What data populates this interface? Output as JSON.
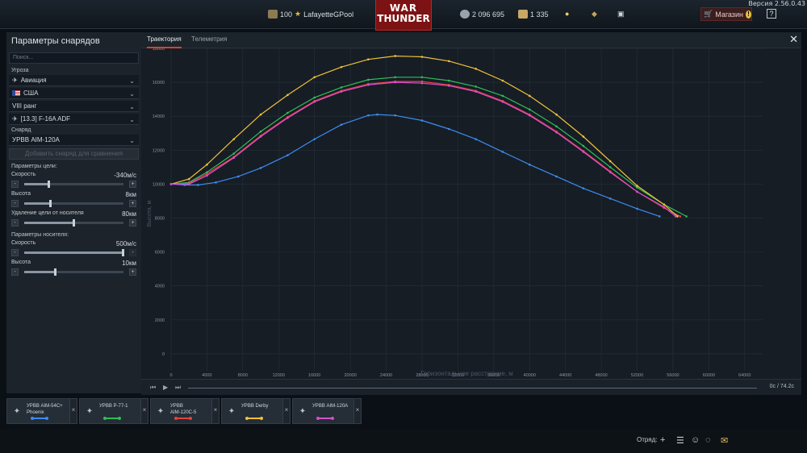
{
  "version": "Версия 2.56.0.43",
  "topbar": {
    "level": "100",
    "username": "LafayetteGPool",
    "logo_line1": "WAR",
    "logo_line2": "THUNDER",
    "silver_lions": "2 096 695",
    "golden_eagles": "1 335",
    "shop_label": "Магазин",
    "help_label": "?"
  },
  "panel": {
    "title": "Параметры снарядов",
    "search_placeholder": "Поиск...",
    "threat_label": "Угроза",
    "threat_type": "Авиация",
    "country": "США",
    "rank": "VIII ранг",
    "vehicle": "[13.3] F-16A ADF",
    "shell_label": "Снаряд",
    "shell": "УРВВ AIM-120A",
    "add_compare": "Добавить снаряд для сравнения",
    "target_params_label": "Параметры цели:",
    "target_speed_label": "Скорость",
    "target_speed_value": "-340м/с",
    "target_speed_level": 0.25,
    "target_alt_label": "Высота",
    "target_alt_value": "8км",
    "target_alt_level": 0.27,
    "target_dist_label": "Удаление цели от носителя",
    "target_dist_value": "80км",
    "target_dist_level": 0.5,
    "carrier_params_label": "Параметры носителя:",
    "carrier_speed_label": "Скорость",
    "carrier_speed_value": "500м/с",
    "carrier_speed_level": 1.0,
    "carrier_alt_label": "Высота",
    "carrier_alt_value": "10км",
    "carrier_alt_level": 0.32,
    "minus": "-",
    "plus": "+"
  },
  "tabs": {
    "trajectory": "Траектория",
    "telemetry": "Телеметрия"
  },
  "close_label": "✕",
  "playbar": {
    "time": "0с / 74.2с"
  },
  "slots": [
    {
      "line1": "УРВВ AIM-54C+",
      "line2": "Phoenix",
      "color": "#3a8df2"
    },
    {
      "line1": "УРВВ Р-77-1",
      "line2": "",
      "color": "#2fbf5a"
    },
    {
      "line1": "УРВВ",
      "line2": "AIM-120C-5",
      "color": "#e8423f"
    },
    {
      "line1": "УРВВ Derby",
      "line2": "",
      "color": "#f0c23a"
    },
    {
      "line1": "УРВВ AIM-120A",
      "line2": "",
      "color": "#d64fd0"
    }
  ],
  "bottombar": {
    "squad_label": "Отряд:"
  },
  "chart_data": {
    "type": "line",
    "xlabel": "Горизонтальное расстояние, м",
    "ylabel": "Высота, м",
    "xlim": [
      0,
      66000
    ],
    "ylim": [
      -1000,
      18000
    ],
    "x_ticks": [
      0,
      4000,
      8000,
      12000,
      16000,
      20000,
      24000,
      28000,
      32000,
      36000,
      40000,
      44000,
      48000,
      52000,
      56000,
      60000,
      64000
    ],
    "y_ticks": [
      0,
      2000,
      4000,
      6000,
      8000,
      10000,
      12000,
      14000,
      16000,
      18000
    ],
    "grid": true,
    "series": [
      {
        "name": "УРВВ AIM-54C+ Phoenix",
        "color": "#3a8df2",
        "x": [
          0,
          1500,
          3000,
          5000,
          7500,
          10000,
          13000,
          16000,
          19000,
          22000,
          23000,
          25000,
          28000,
          31000,
          34000,
          37000,
          40000,
          43000,
          46000,
          49000,
          52000,
          54500
        ],
        "y": [
          10000,
          9950,
          9950,
          10100,
          10450,
          10950,
          11700,
          12650,
          13500,
          14050,
          14100,
          14050,
          13750,
          13250,
          12650,
          11900,
          11150,
          10450,
          9750,
          9150,
          8550,
          8100
        ]
      },
      {
        "name": "УРВВ Р-77-1",
        "color": "#2fbf5a",
        "x": [
          0,
          2000,
          4000,
          7000,
          10000,
          13000,
          16000,
          19000,
          22000,
          25000,
          28000,
          31000,
          34000,
          37000,
          40000,
          43000,
          46000,
          49000,
          52000,
          55000,
          57500
        ],
        "y": [
          10000,
          10100,
          10700,
          11800,
          13100,
          14200,
          15100,
          15700,
          16150,
          16300,
          16300,
          16100,
          15750,
          15200,
          14400,
          13400,
          12250,
          11000,
          9800,
          8800,
          8100
        ]
      },
      {
        "name": "УРВВ AIM-120C-5",
        "color": "#e8423f",
        "x": [
          0,
          2000,
          4000,
          7000,
          10000,
          13000,
          16000,
          19000,
          22000,
          25000,
          28000,
          31000,
          34000,
          37000,
          40000,
          43000,
          46000,
          49000,
          52000,
          55000,
          56800
        ],
        "y": [
          10000,
          10050,
          10600,
          11600,
          12850,
          13950,
          14900,
          15500,
          15900,
          16050,
          16050,
          15850,
          15500,
          14900,
          14100,
          13100,
          11950,
          10750,
          9550,
          8600,
          8100
        ]
      },
      {
        "name": "УРВВ Derby",
        "color": "#f0c23a",
        "x": [
          0,
          2000,
          4000,
          7000,
          10000,
          13000,
          16000,
          19000,
          22000,
          25000,
          28000,
          31000,
          34000,
          37000,
          40000,
          43000,
          46000,
          49000,
          52000,
          55000,
          56500
        ],
        "y": [
          10000,
          10300,
          11150,
          12650,
          14100,
          15250,
          16300,
          16900,
          17350,
          17550,
          17500,
          17250,
          16800,
          16100,
          15200,
          14100,
          12800,
          11350,
          9900,
          8800,
          8100
        ]
      },
      {
        "name": "УРВВ AIM-120A",
        "color": "#d64fd0",
        "x": [
          0,
          2000,
          4000,
          7000,
          10000,
          13000,
          16000,
          19000,
          22000,
          25000,
          28000,
          31000,
          34000,
          37000,
          40000,
          43000,
          46000,
          49000,
          52000,
          55000,
          56300
        ],
        "y": [
          10000,
          10000,
          10500,
          11550,
          12800,
          13900,
          14850,
          15450,
          15850,
          16000,
          15950,
          15800,
          15450,
          14850,
          14050,
          13050,
          11900,
          10700,
          9550,
          8650,
          8100
        ]
      }
    ]
  }
}
